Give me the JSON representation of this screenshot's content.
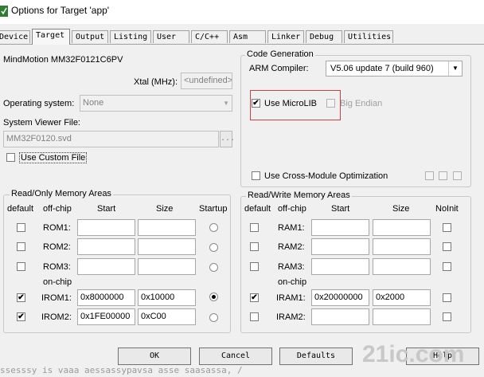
{
  "window": {
    "title": "Options for Target 'app'"
  },
  "tabs": [
    "Device",
    "Target",
    "Output",
    "Listing",
    "User",
    "C/C++",
    "Asm",
    "Linker",
    "Debug",
    "Utilities"
  ],
  "target": {
    "device_name": "MindMotion MM32F0121C6PV",
    "xtal_label": "Xtal (MHz):",
    "xtal_value": "<undefined>",
    "os_label": "Operating system:",
    "os_value": "None",
    "sysviewer_label": "System Viewer File:",
    "sysviewer_value": "MM32F0120.svd",
    "sysviewer_browse": "...",
    "use_custom_file": "Use Custom File"
  },
  "codegen": {
    "legend": "Code Generation",
    "compiler_label": "ARM Compiler:",
    "compiler_value": "V5.06 update 7 (build 960)",
    "use_microlib": "Use MicroLIB",
    "big_endian": "Big Endian",
    "cross_module": "Use Cross-Module Optimization"
  },
  "rom": {
    "legend": "Read/Only Memory Areas",
    "headers": {
      "default": "default",
      "offchip": "off-chip",
      "start": "Start",
      "size": "Size",
      "startup": "Startup"
    },
    "onchip": "on-chip",
    "rows": [
      {
        "name": "ROM1:",
        "start": "",
        "size": "",
        "default": false,
        "startup": false
      },
      {
        "name": "ROM2:",
        "start": "",
        "size": "",
        "default": false,
        "startup": false
      },
      {
        "name": "ROM3:",
        "start": "",
        "size": "",
        "default": false,
        "startup": false
      },
      {
        "name": "IROM1:",
        "start": "0x8000000",
        "size": "0x10000",
        "default": true,
        "startup": true
      },
      {
        "name": "IROM2:",
        "start": "0x1FE00000",
        "size": "0xC00",
        "default": true,
        "startup": false
      }
    ]
  },
  "ram": {
    "legend": "Read/Write Memory Areas",
    "headers": {
      "default": "default",
      "offchip": "off-chip",
      "start": "Start",
      "size": "Size",
      "noinit": "NoInit"
    },
    "onchip": "on-chip",
    "rows": [
      {
        "name": "RAM1:",
        "start": "",
        "size": "",
        "default": false
      },
      {
        "name": "RAM2:",
        "start": "",
        "size": "",
        "default": false
      },
      {
        "name": "RAM3:",
        "start": "",
        "size": "",
        "default": false
      },
      {
        "name": "IRAM1:",
        "start": "0x20000000",
        "size": "0x2000",
        "default": true
      },
      {
        "name": "IRAM2:",
        "start": "",
        "size": "",
        "default": false
      }
    ]
  },
  "buttons": {
    "ok": "OK",
    "cancel": "Cancel",
    "defaults": "Defaults",
    "help": "Help"
  },
  "background_code": "ssesssy is vaaa aessassypavsa asse saasassa, /",
  "watermark": "21ic.com",
  "check_mark": "✔"
}
